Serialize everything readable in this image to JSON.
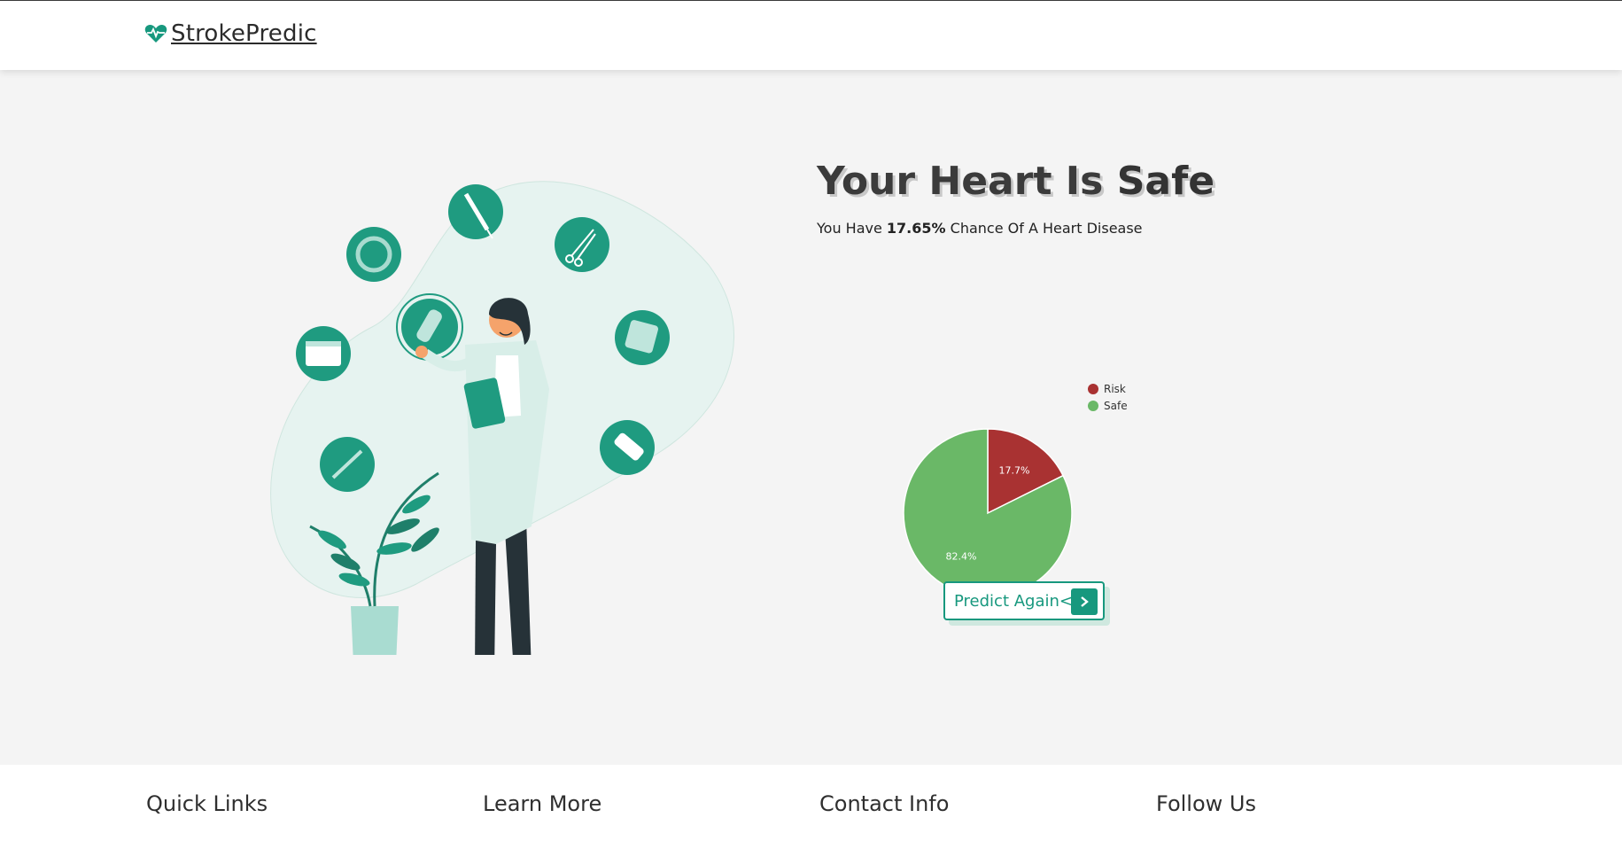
{
  "header": {
    "brand_name": "StrokePredic",
    "brand_icon": "heart-pulse-icon",
    "brand_color": "#17987e"
  },
  "result": {
    "headline_prefix": "Your Heart Is",
    "headline_status": "Safe",
    "sub_prefix": "You Have",
    "sub_percent": "17.65%",
    "sub_suffix": "Chance Of A Heart Disease"
  },
  "chart_data": {
    "type": "pie",
    "categories": [
      "Risk",
      "Safe"
    ],
    "values": [
      17.65,
      82.35
    ],
    "data_labels": [
      "17.7%",
      "82.4%"
    ],
    "colors": [
      "#a93232",
      "#6ab867"
    ],
    "legend_position": "top-right"
  },
  "actions": {
    "predict_again_label": "Predict Again<",
    "predict_again_icon": "chevron-right-icon"
  },
  "footer": {
    "quick_links": "Quick Links",
    "learn_more": "Learn More",
    "contact_info": "Contact Info",
    "follow_us": "Follow Us"
  },
  "colors": {
    "accent": "#17987e",
    "background": "#f4f4f4"
  }
}
